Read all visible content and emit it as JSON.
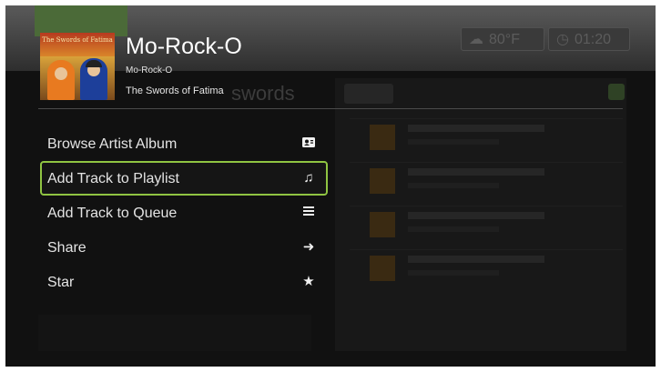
{
  "status_bar": {
    "weather": "80°F",
    "clock": "01:20"
  },
  "background": {
    "heading": "swords"
  },
  "track": {
    "title": "Mo-Rock-O",
    "subtitle": "Mo-Rock-O",
    "artist": "The Swords of Fatima",
    "art_caption": "The Swords of Fatima"
  },
  "menu": {
    "items": [
      {
        "label": "Browse Artist Album",
        "icon": "artist-card-icon",
        "selected": false
      },
      {
        "label": "Add Track to Playlist",
        "icon": "music-note-icon",
        "selected": true
      },
      {
        "label": "Add Track to Queue",
        "icon": "queue-list-icon",
        "selected": false
      },
      {
        "label": "Share",
        "icon": "arrow-right-icon",
        "selected": false
      },
      {
        "label": "Star",
        "icon": "star-icon",
        "selected": false
      }
    ]
  },
  "colors": {
    "selection_border": "#8fc442",
    "background": "#111111"
  }
}
